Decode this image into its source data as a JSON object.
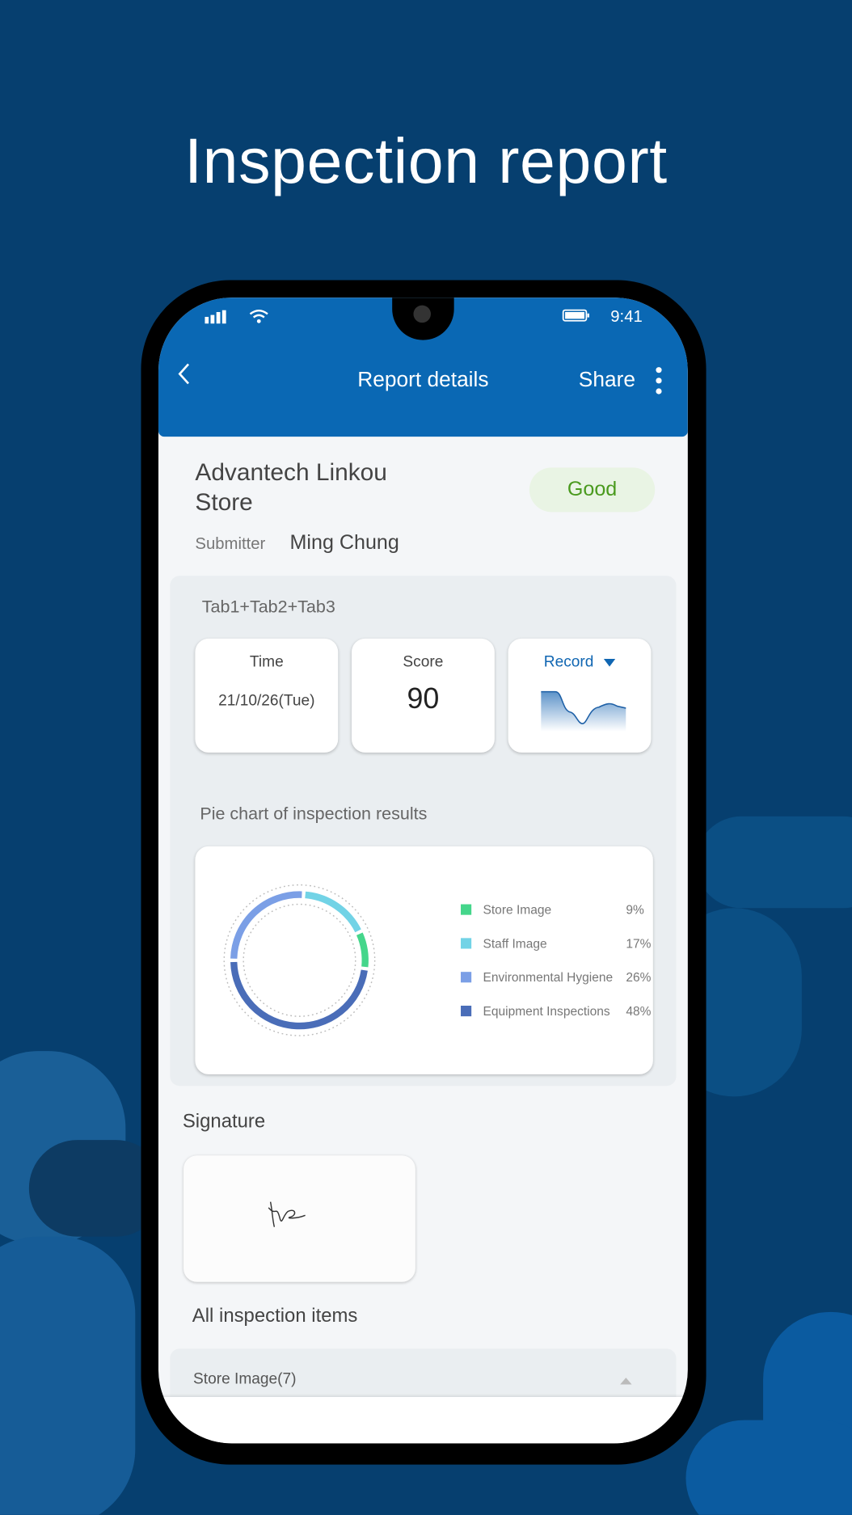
{
  "banner_title": "Inspection report",
  "status_bar": {
    "time": "9:41"
  },
  "header": {
    "title": "Report details",
    "share_label": "Share",
    "back_icon": "chevron-left-icon",
    "more_icon": "more-vertical-icon"
  },
  "report": {
    "store_name": "Advantech Linkou Store",
    "status_badge": "Good",
    "submitter_label": "Submitter",
    "submitter_name": "Ming Chung",
    "tabs_label": "Tab1+Tab2+Tab3",
    "time_label": "Time",
    "time_value": "21/10/26(Tue)",
    "score_label": "Score",
    "score_value": "90",
    "record_label": "Record"
  },
  "pie_section": {
    "title": "Pie chart of inspection results"
  },
  "chart_data": {
    "type": "pie",
    "title": "Pie chart of inspection results",
    "categories": [
      "Store Image",
      "Staff Image",
      "Environmental Hygiene",
      "Equipment Inspections"
    ],
    "values": [
      9,
      17,
      26,
      48
    ],
    "labels": [
      "9%",
      "17%",
      "26%",
      "48%"
    ],
    "colors": [
      "#45d68b",
      "#72d3e6",
      "#7b9fe6",
      "#4a6db8"
    ],
    "legend": "right"
  },
  "signature": {
    "title": "Signature"
  },
  "inspection_items": {
    "title": "All inspection items",
    "first_group": "Store Image(7)"
  },
  "colors": {
    "brand": "#0a68b4",
    "good": "#4a9a1e",
    "background": "#063f6f"
  }
}
